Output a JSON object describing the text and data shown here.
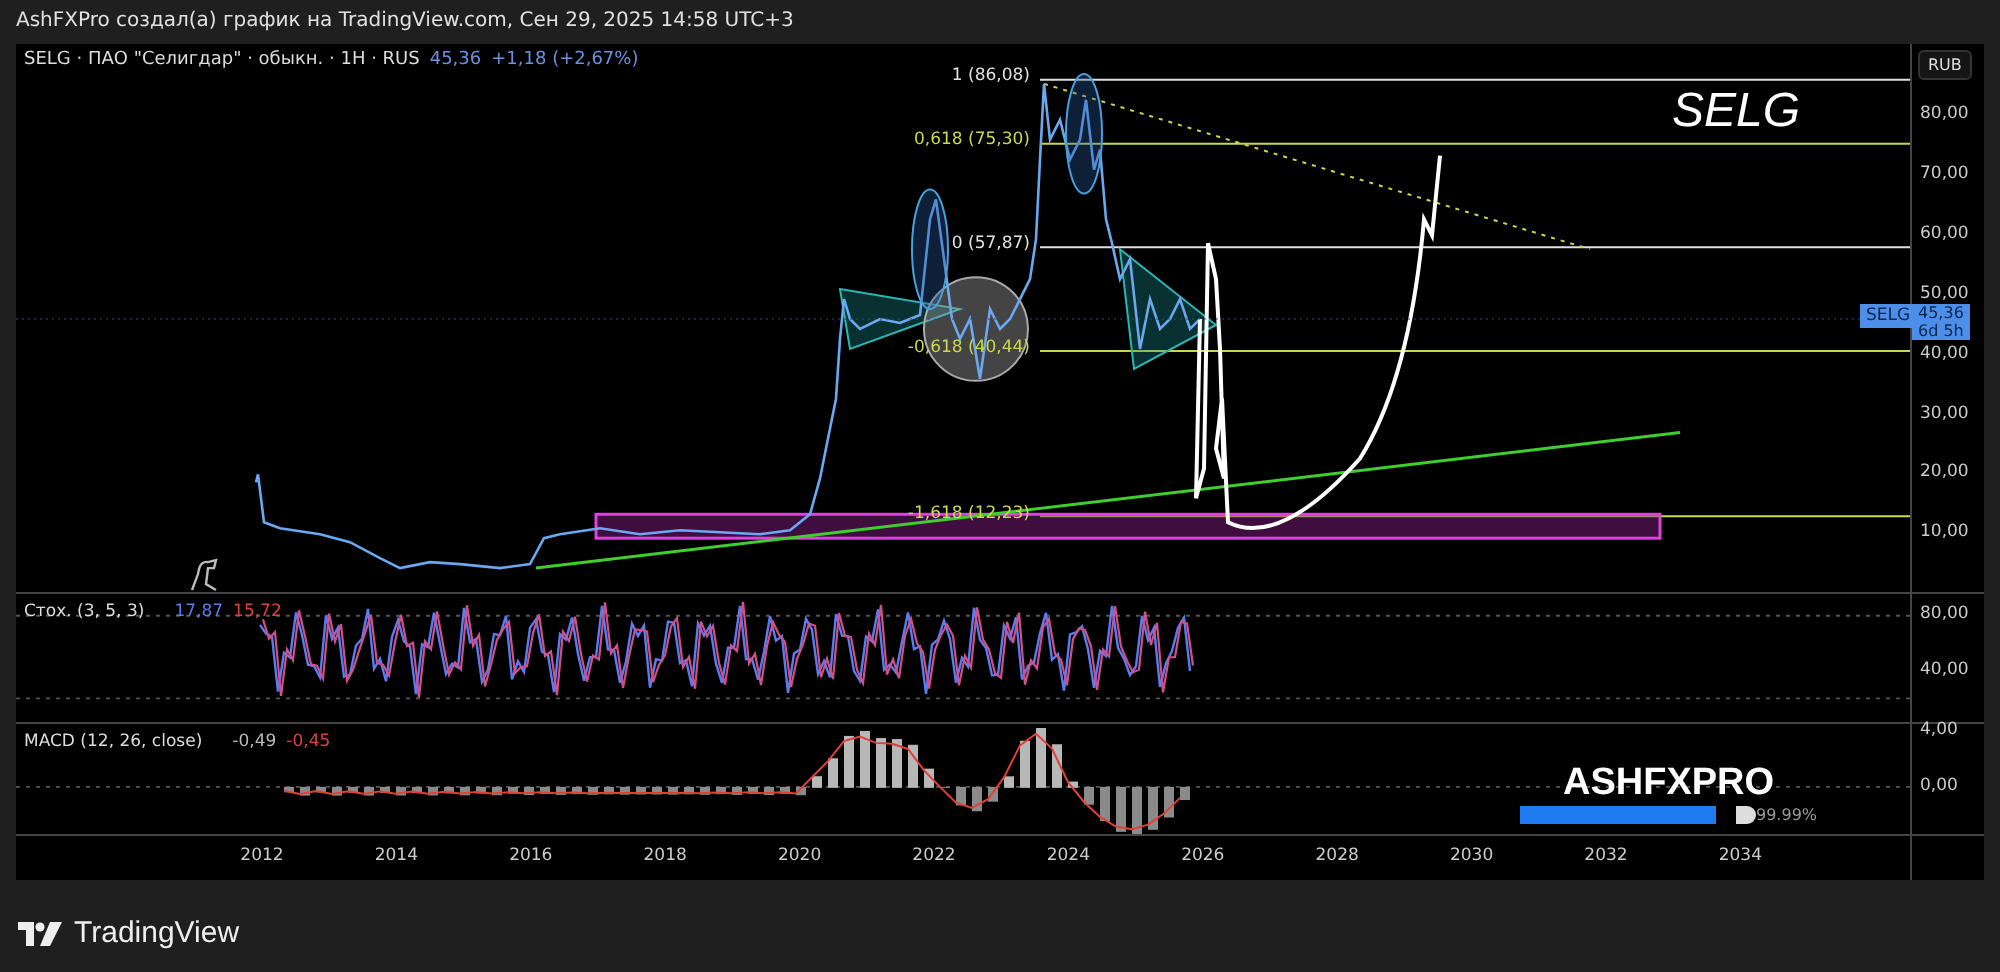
{
  "header": {
    "caption": "AshFXPro создал(а) график на TradingView.com, Сен 29, 2025 14:58 UTC+3"
  },
  "legend": {
    "symbol": "SELG · ПАО \"Селигдар\" · обыкн. · 1H · RUS",
    "price": "45,36",
    "change": "+1,18 (+2,67%)"
  },
  "main_pane": {
    "title": "SELG",
    "fib_levels": [
      {
        "label": "1 (86,08)",
        "color": "#e0e0e0"
      },
      {
        "label": "0,618 (75,30)",
        "color": "#c9d84c"
      },
      {
        "label": "0 (57,87)",
        "color": "#e0e0e0"
      },
      {
        "label": "-0,618 (40,44)",
        "color": "#c9d84c"
      },
      {
        "label": "-1,618 (12,23)",
        "color": "#c9d84c"
      }
    ]
  },
  "price_axis": {
    "currency": "RUB",
    "ticks": [
      "80,00",
      "70,00",
      "60,00",
      "50,00",
      "40,00",
      "30,00",
      "20,00",
      "10,00"
    ],
    "price_label": {
      "symbol": "SELG",
      "price": "45,36",
      "countdown": "6d 5h"
    }
  },
  "stochastic": {
    "title": "Стох. (3, 5, 3)",
    "k": "17,87",
    "d": "15,72",
    "ticks": [
      "80,00",
      "40,00"
    ]
  },
  "macd": {
    "title": "MACD (12, 26, close)",
    "macd": "-0,49",
    "signal": "-0,45",
    "ticks": [
      "4,00",
      "0,00"
    ]
  },
  "time_axis": {
    "ticks": [
      "2012",
      "2014",
      "2016",
      "2018",
      "2020",
      "2022",
      "2024",
      "2026",
      "2028",
      "2030",
      "2032",
      "2034"
    ]
  },
  "badge": {
    "text": "ASHFXPRO",
    "level": 0.9999,
    "reading": "99.99%"
  },
  "footer": {
    "logo": "TradingView"
  }
}
